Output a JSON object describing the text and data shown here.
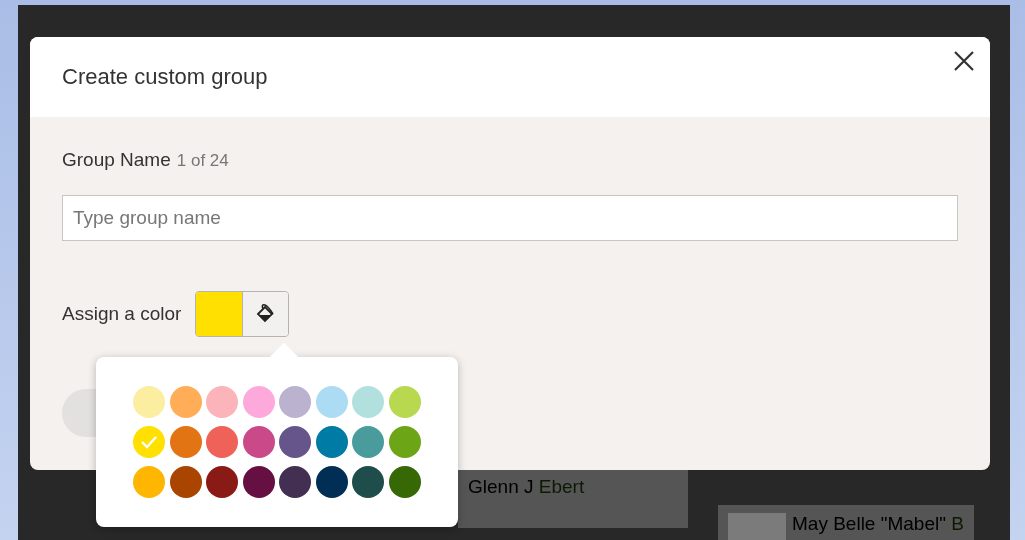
{
  "background": {
    "nodes": [
      {
        "first": "Glenn J",
        "last": "Ebert",
        "photo": false
      },
      {
        "first": "May Belle \"Mabel\"",
        "last": "B",
        "photo": true
      }
    ]
  },
  "dialog": {
    "title": "Create custom group",
    "group_name": {
      "label": "Group Name",
      "counter": "1 of 24",
      "placeholder": "Type group name"
    },
    "color": {
      "label": "Assign a color"
    },
    "palette": [
      {
        "color": "#fbeea0",
        "selected": false
      },
      {
        "color": "#ffad57",
        "selected": false
      },
      {
        "color": "#fbb4b9",
        "selected": false
      },
      {
        "color": "#fea9dc",
        "selected": false
      },
      {
        "color": "#bab2cf",
        "selected": false
      },
      {
        "color": "#acdcf3",
        "selected": false
      },
      {
        "color": "#b1e0df",
        "selected": false
      },
      {
        "color": "#b8d84f",
        "selected": false
      },
      {
        "color": "#ffe000",
        "selected": true
      },
      {
        "color": "#e27413",
        "selected": false
      },
      {
        "color": "#ef6259",
        "selected": false
      },
      {
        "color": "#c94989",
        "selected": false
      },
      {
        "color": "#65558b",
        "selected": false
      },
      {
        "color": "#007ba5",
        "selected": false
      },
      {
        "color": "#4a9c9c",
        "selected": false
      },
      {
        "color": "#6ca617",
        "selected": false
      },
      {
        "color": "#ffb600",
        "selected": false
      },
      {
        "color": "#a94500",
        "selected": false
      },
      {
        "color": "#8a1a15",
        "selected": false
      },
      {
        "color": "#660f42",
        "selected": false
      },
      {
        "color": "#422f52",
        "selected": false
      },
      {
        "color": "#002e54",
        "selected": false
      },
      {
        "color": "#1f4d4b",
        "selected": false
      },
      {
        "color": "#376806",
        "selected": false
      }
    ]
  }
}
